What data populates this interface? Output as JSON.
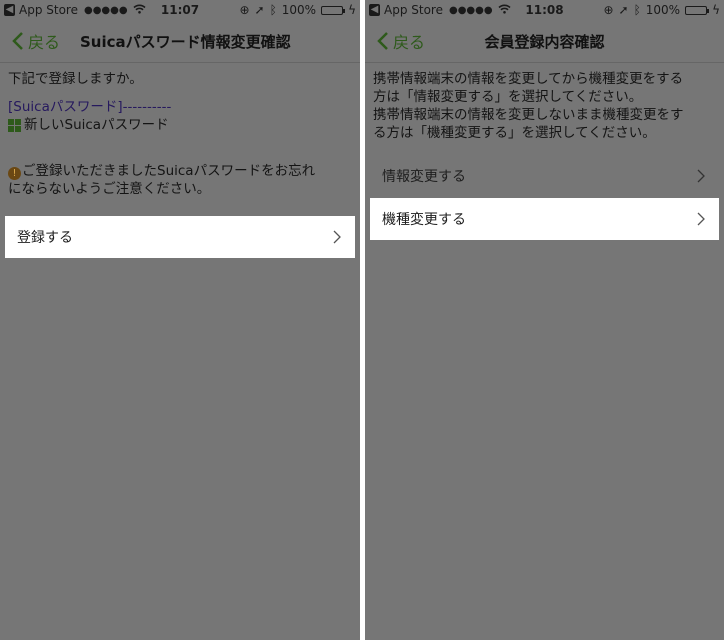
{
  "left": {
    "status": {
      "carrier": "App Store",
      "signal": "●●●●●",
      "time": "11:07",
      "battery": "100%"
    },
    "nav": {
      "back_label": "戻る",
      "title": "Suicaパスワード情報変更確認"
    },
    "confirm_text": "下記で登録しますか。",
    "pw_label": "[Suicaパスワード]----------",
    "pw_desc": "新しいSuicaパスワード",
    "notice_line1": "ご登録いただきましたSuicaパスワードをお忘れ",
    "notice_line2": "にならないようご注意ください。",
    "register_button": "登録する"
  },
  "right": {
    "status": {
      "carrier": "App Store",
      "signal": "●●●●●",
      "time": "11:08",
      "battery": "100%"
    },
    "nav": {
      "back_label": "戻る",
      "title": "会員登録内容確認"
    },
    "intro_line1": "携帯情報端末の情報を変更してから機種変更をする",
    "intro_line2": "方は「情報変更する」を選択してください。",
    "intro_line3": "携帯情報端末の情報を変更しないまま機種変更をす",
    "intro_line4": "る方は「機種変更する」を選択してください。",
    "info_change_item": "情報変更する",
    "device_change_item": "機種変更する"
  },
  "colors": {
    "overlay": "#767676",
    "accent": "#2e5a1b",
    "highlight": "#ffffff"
  }
}
